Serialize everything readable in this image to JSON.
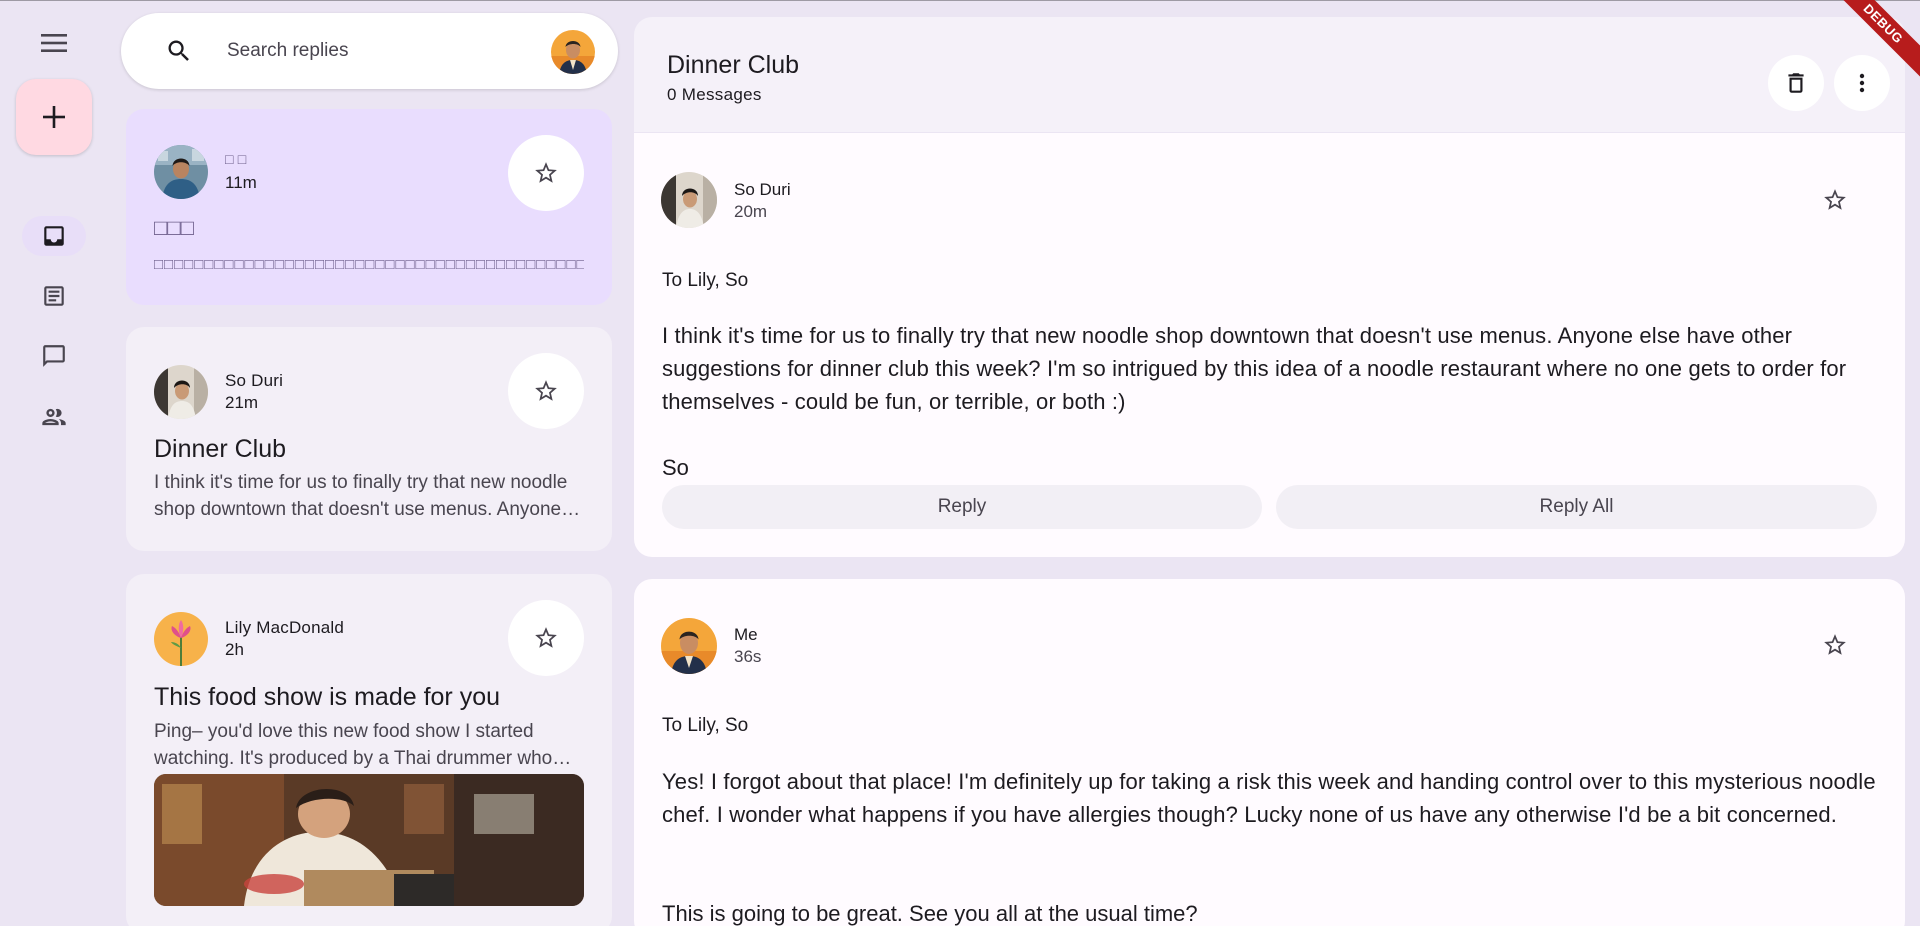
{
  "rail": {
    "menu_icon": "menu-icon",
    "compose_icon": "add-icon",
    "items": [
      {
        "icon": "inbox-icon",
        "active": true
      },
      {
        "icon": "article-icon",
        "active": false
      },
      {
        "icon": "chat-icon",
        "active": false
      },
      {
        "icon": "group-icon",
        "active": false
      }
    ]
  },
  "search": {
    "placeholder": "Search replies",
    "icon": "search-icon",
    "avatar": "user-avatar"
  },
  "emails": [
    {
      "sender": "□ □",
      "time": "11m",
      "subject": "□□□",
      "preview": "□□□□□□□□□□□□□□□□□□□□□□□□□□□□□□□□□□□□□□□□□□□□",
      "selected": true
    },
    {
      "sender": "So Duri",
      "time": "21m",
      "subject": "Dinner Club",
      "preview": "I think it's time for us to finally try that new noodle shop downtown that doesn't use menus. Anyone else have other suggestions for dinner club this week?",
      "selected": false
    },
    {
      "sender": "Lily MacDonald",
      "time": "2h",
      "subject": "This food show is made for you",
      "preview": "Ping– you'd love this new food show I started watching. It's produced by a Thai drummer who started getting recognized for the amazing vegan food she always brought to shows.",
      "selected": false,
      "has_image": true
    }
  ],
  "detail": {
    "title": "Dinner Club",
    "count": "0 Messages",
    "delete_icon": "delete-icon",
    "more_icon": "more-vert-icon",
    "messages": [
      {
        "sender": "So Duri",
        "time": "20m",
        "to": "To Lily, So",
        "body": "I think it's time for us to finally try that new noodle shop downtown that doesn't use menus. Anyone else have other suggestions for dinner club this week? I'm so intrigued by this idea of a noodle restaurant where no one gets to order for themselves - could be fun, or terrible, or both :)",
        "signature": "So",
        "reply_label": "Reply",
        "reply_all_label": "Reply All"
      },
      {
        "sender": "Me",
        "time": "36s",
        "to": "To Lily, So",
        "body": "Yes! I forgot about that place! I'm definitely up for taking a risk this week and handing control over to this mysterious noodle chef. I wonder what happens if you have allergies though? Lucky none of us have any otherwise I'd be a bit concerned.",
        "signature": "This is going to be great. See you all at the usual time?"
      }
    ]
  },
  "debug_banner": "DEBUG",
  "colors": {
    "background": "#ebe5f3",
    "selected_card": "#e9ddfe",
    "card": "#f3eff7",
    "compose_fab": "#ffd9e2",
    "rail_active": "#e8def8",
    "debug": "#b71c1c"
  }
}
